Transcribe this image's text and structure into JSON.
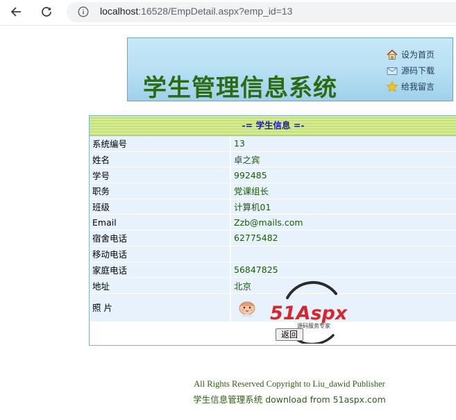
{
  "browser": {
    "url_host": "localhost",
    "url_rest": ":16528/EmpDetail.aspx?emp_id=13"
  },
  "banner": {
    "title": "学生管理信息系统",
    "links": [
      {
        "label": "设为首页",
        "icon": "home-icon"
      },
      {
        "label": "源码下载",
        "icon": "mail-icon"
      },
      {
        "label": "给我留言",
        "icon": "star-icon"
      }
    ]
  },
  "panel": {
    "heading": "-= 学生信息 =-",
    "rows": [
      {
        "label": "系统编号",
        "value": "13"
      },
      {
        "label": "姓名",
        "value": "卓之宾"
      },
      {
        "label": "学号",
        "value": "992485"
      },
      {
        "label": "职务",
        "value": "党课组长"
      },
      {
        "label": "班级",
        "value": "计算机01"
      },
      {
        "label": "Email",
        "value": "Zzb@mails.com"
      },
      {
        "label": "宿舍电话",
        "value": "62775482"
      },
      {
        "label": "移动电话",
        "value": ""
      },
      {
        "label": "家庭电话",
        "value": "56847825"
      },
      {
        "label": "地址",
        "value": "北京"
      }
    ],
    "photo_label": "照 片",
    "back_button": "返回"
  },
  "watermark": {
    "brand": "51Aspx",
    "tagline": "源码服务专家"
  },
  "footer": {
    "line1": "All Rights Reserved    Copyright to Liu_dawid Publisher",
    "line2": "学生信息管理系统 download from 51aspx.com"
  },
  "colors": {
    "title_green": "#2c6a14",
    "heading_blue": "#1a1ab3",
    "value_green": "#1d5a0c",
    "row_bg": "#e8f2fc"
  }
}
